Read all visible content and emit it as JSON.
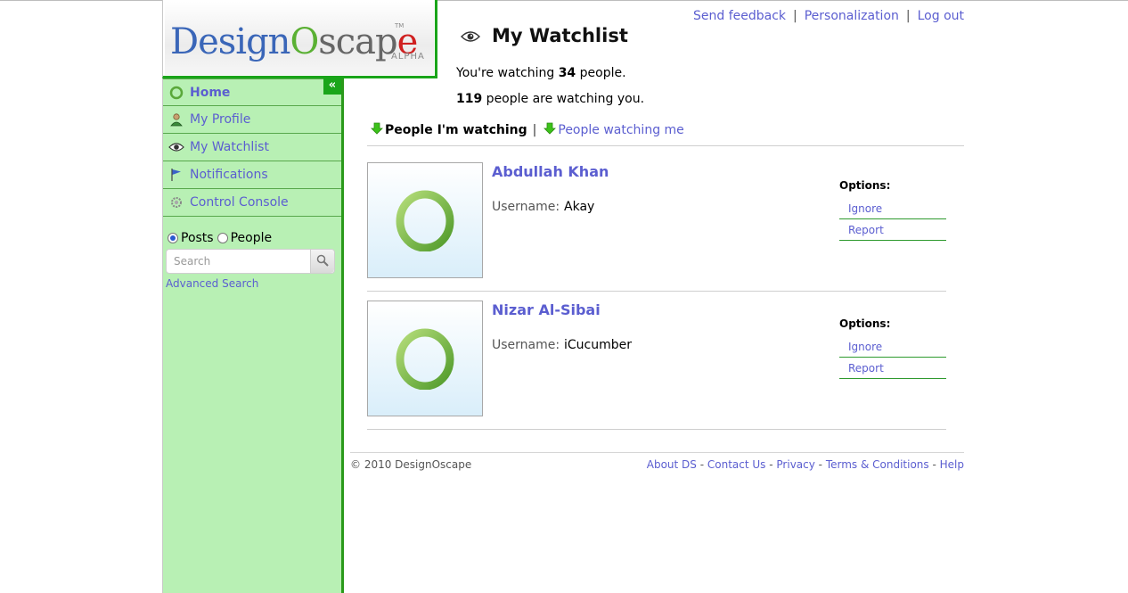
{
  "header": {
    "links": {
      "feedback": "Send feedback",
      "personalization": "Personalization",
      "logout": "Log out",
      "separator": "|"
    }
  },
  "logo": {
    "part1": "Design",
    "part2": "O",
    "part3": "scap",
    "part4": "e",
    "tm": "TM",
    "badge": "ALPHA"
  },
  "sidebar": {
    "collapse_label": "«",
    "items": [
      {
        "label": "Home",
        "icon": "home-ring-icon"
      },
      {
        "label": "My Profile",
        "icon": "person-icon"
      },
      {
        "label": "My Watchlist",
        "icon": "eye-icon"
      },
      {
        "label": "Notifications",
        "icon": "flag-icon"
      },
      {
        "label": "Control Console",
        "icon": "gear-icon"
      }
    ],
    "search": {
      "scope_posts": "Posts",
      "scope_people": "People",
      "selected_scope": "Posts",
      "placeholder": "Search",
      "value": "",
      "advanced": "Advanced Search"
    }
  },
  "main": {
    "title": "My Watchlist",
    "stats": {
      "watching_prefix": "You're watching ",
      "watching_count": "34",
      "watching_suffix": " people.",
      "watchers_count": "119",
      "watchers_suffix": " people are watching you."
    },
    "tabs": [
      {
        "label": "People I'm watching",
        "active": true
      },
      {
        "label": "People watching me",
        "active": false
      }
    ],
    "tab_separator": "|",
    "people": [
      {
        "name": "Abdullah Khan",
        "username_label": "Username:",
        "username": "Akay",
        "options_title": "Options:",
        "options": [
          "Ignore",
          "Report"
        ]
      },
      {
        "name": "Nizar Al-Sibai",
        "username_label": "Username:",
        "username": "iCucumber",
        "options_title": "Options:",
        "options": [
          "Ignore",
          "Report"
        ]
      }
    ]
  },
  "footer": {
    "copyright": "© 2010 DesignOscape",
    "links": [
      "About DS",
      "Contact Us",
      "Privacy",
      "Terms & Conditions",
      "Help"
    ],
    "separator": " - "
  },
  "colors": {
    "sidebar_bg": "#b8f0b4",
    "accent_green": "#1aa51a",
    "link_blue": "#5b5ed0"
  }
}
